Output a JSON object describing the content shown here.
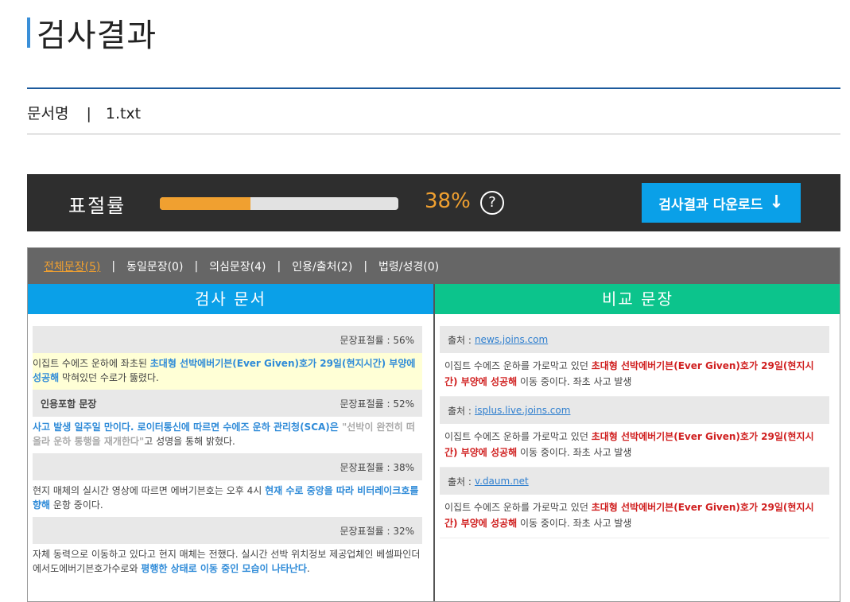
{
  "page": {
    "title": "검사결과"
  },
  "document": {
    "label": "문서명",
    "separator": "|",
    "filename": "1.txt"
  },
  "rate": {
    "label": "표절률",
    "value": 38,
    "percent_text": "38%",
    "help": "?",
    "download_label": "검사결과 다운로드",
    "download_arrow": "↓"
  },
  "tabs": [
    {
      "label": "전체문장(5)"
    },
    {
      "label": "동일문장(0)"
    },
    {
      "label": "의심문장(4)"
    },
    {
      "label": "인용/출처(2)"
    },
    {
      "label": "법령/성경(0)"
    }
  ],
  "tab_separator": "|",
  "columns": {
    "left": "검사 문서",
    "right": "비교 문장"
  },
  "left": [
    {
      "tag": "",
      "rate": "문장표절률 : 56%",
      "parts": [
        "이집트 수에즈 운하에 좌초된 ",
        "초대형 선박에버기븐(Ever Given)호가 29일(현지시간) 부양에 성공해",
        " 막혀있던 수로가 뚫렸다."
      ]
    },
    {
      "tag": "인용포함 문장",
      "rate": "문장표절률 : 52%",
      "parts": [
        "사고 발생 일주일 만이다. 로이터통신에 따르면 수에즈 운하 관리청(SCA)은 ",
        "\"선박이 완전히 떠올라 운하 통행을 재개한다\"",
        "고 성명을 통해 밝혔다."
      ]
    },
    {
      "tag": "",
      "rate": "문장표절률 : 38%",
      "parts": [
        "현지 매체의 실시간 영상에 따르면 에버기븐호는 오후 4시 ",
        "현재 수로 중앙을 따라 비터레이크호를 향해",
        " 운항 중이다."
      ]
    },
    {
      "tag": "",
      "rate": "문장표절률 : 32%",
      "parts": [
        "자체 동력으로 이동하고 있다고 현지 매체는 전했다. 실시간 선박 위치정보 제공업체인 베셀파인더에서도에버기븐호가수로와 ",
        "평행한 상태로 이동 중인 모습이 나타난다",
        "."
      ]
    }
  ],
  "right": [
    {
      "source_label": "출처 :",
      "source": "news.joins.com",
      "parts": [
        "이집트 수에즈 운하를 가로막고 있던 ",
        "초대형 선박에버기븐(Ever Given)호가 29일(현지시간) 부양에 성공해",
        " 이동 중이다. 좌초 사고 발생"
      ]
    },
    {
      "source_label": "출처 :",
      "source": "isplus.live.joins.com",
      "parts": [
        "이집트 수에즈 운하를 가로막고 있던 ",
        "초대형 선박에버기븐(Ever Given)호가 29일(현지시간) 부양에 성공해",
        " 이동 중이다. 좌초 사고 발생"
      ]
    },
    {
      "source_label": "출처 :",
      "source": "v.daum.net",
      "parts": [
        "이집트 수에즈 운하를 가로막고 있던 ",
        "초대형 선박에버기븐(Ever Given)호가 29일(현지시간) 부양에 성공해",
        " 이동 중이다. 좌초 사고 발생"
      ]
    }
  ],
  "colors": {
    "accent_orange": "#f0a030",
    "accent_blue": "#0aa0e8",
    "accent_green": "#0cc48c",
    "match_red": "#d02020"
  }
}
